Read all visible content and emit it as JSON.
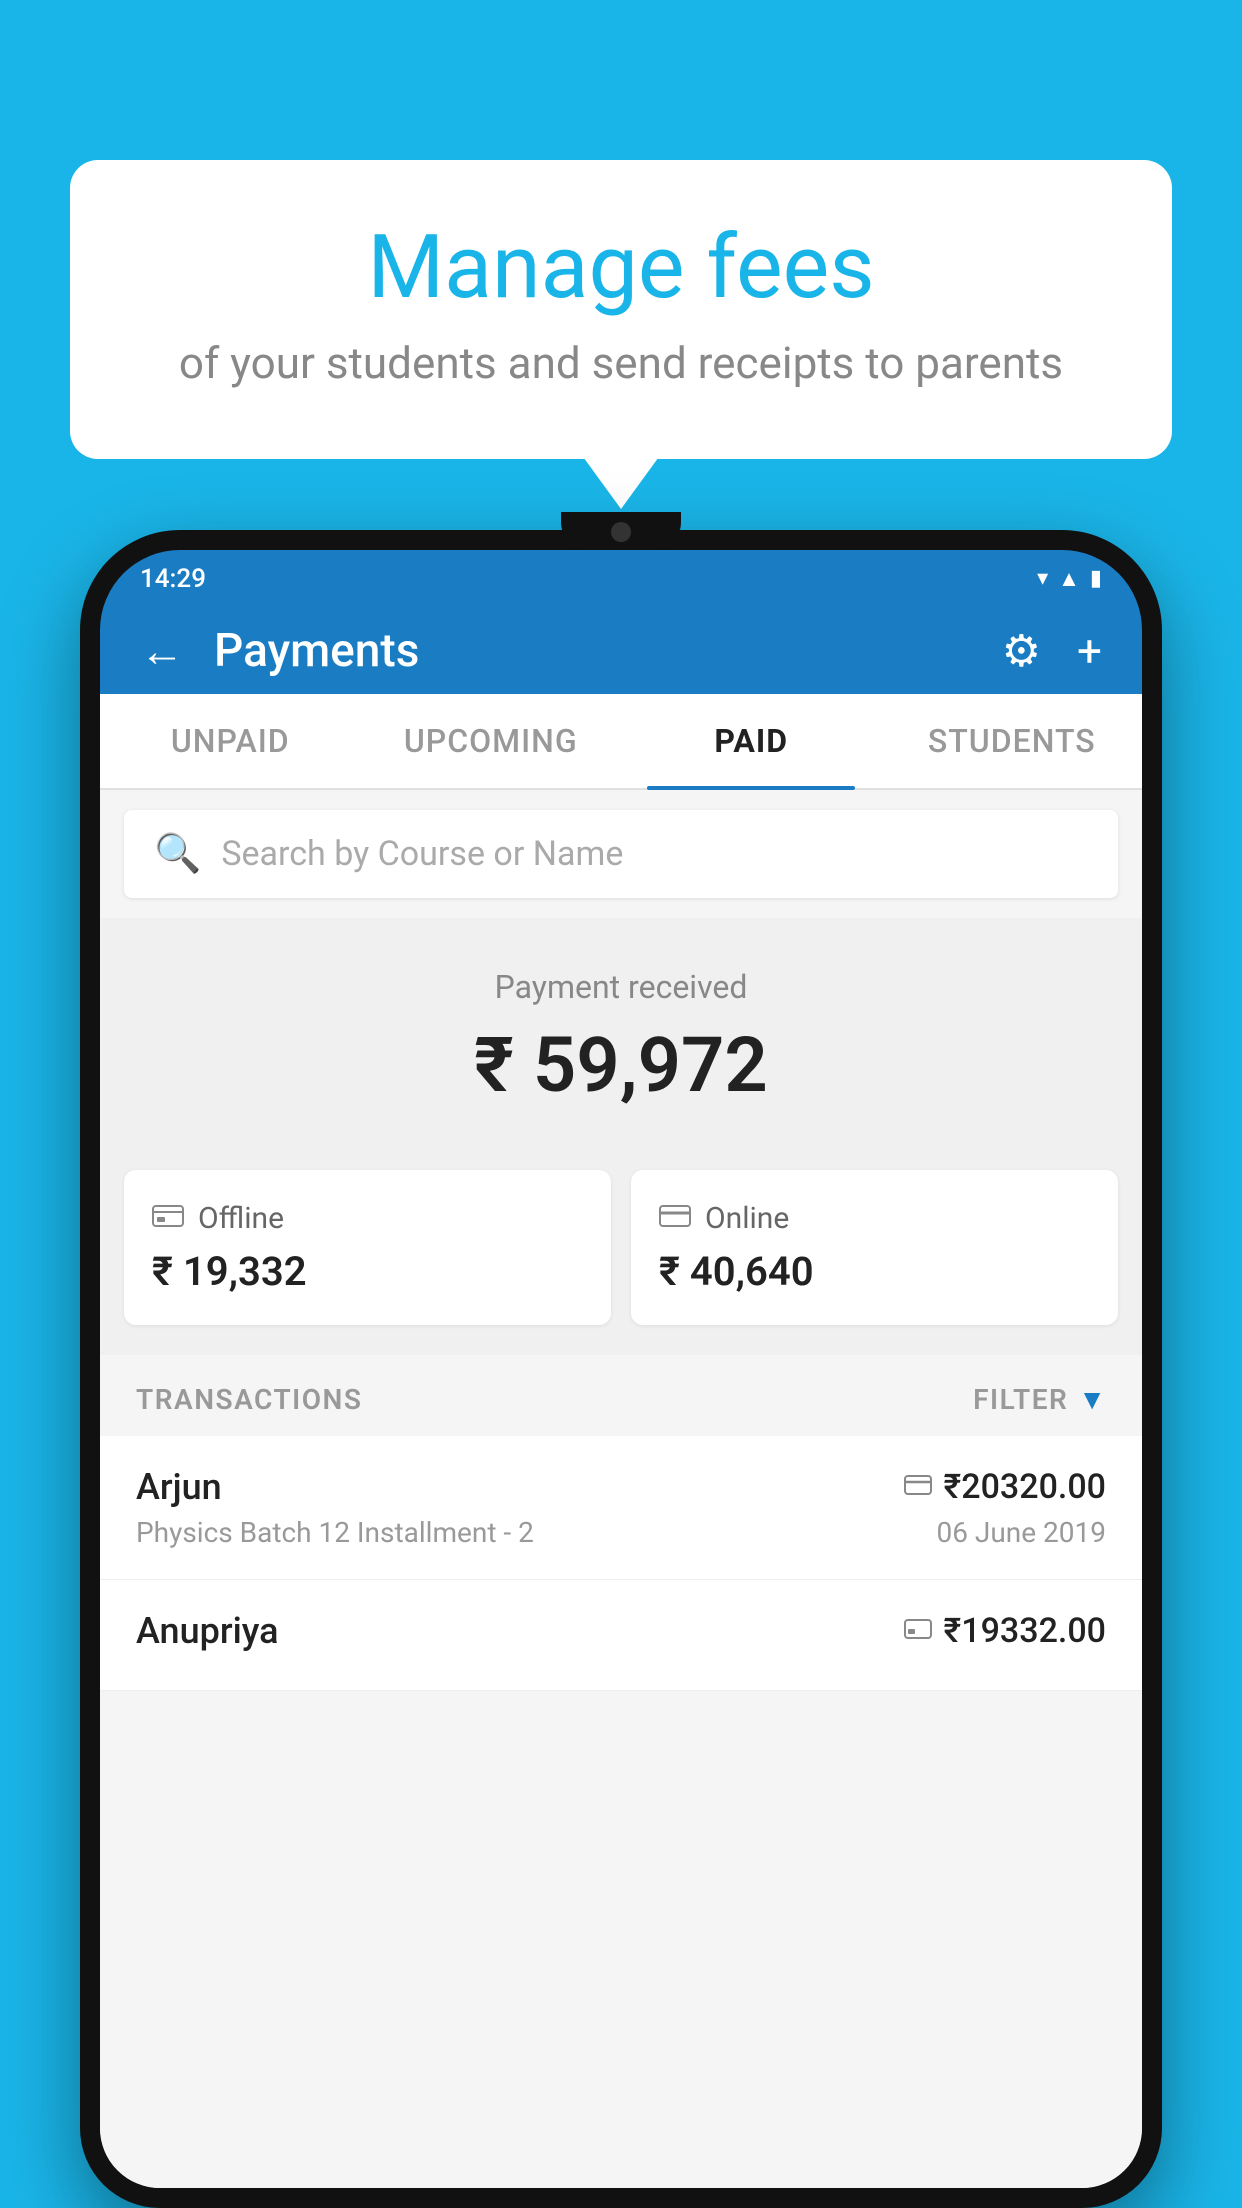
{
  "background_color": "#1ab5e8",
  "bubble": {
    "title": "Manage fees",
    "subtitle": "of your students and send receipts to parents"
  },
  "phone": {
    "status_bar": {
      "time": "14:29",
      "wifi": "▼",
      "signal": "▲",
      "battery": "▮"
    },
    "header": {
      "back_label": "←",
      "title": "Payments",
      "settings_icon": "⚙",
      "add_icon": "+"
    },
    "tabs": [
      {
        "label": "UNPAID",
        "active": false
      },
      {
        "label": "UPCOMING",
        "active": false
      },
      {
        "label": "PAID",
        "active": true
      },
      {
        "label": "STUDENTS",
        "active": false
      }
    ],
    "search": {
      "placeholder": "Search by Course or Name"
    },
    "payment_received": {
      "label": "Payment received",
      "amount": "₹ 59,972"
    },
    "cards": [
      {
        "icon": "💳",
        "label": "Offline",
        "amount": "₹ 19,332"
      },
      {
        "icon": "💳",
        "label": "Online",
        "amount": "₹ 40,640"
      }
    ],
    "transactions": {
      "label": "TRANSACTIONS",
      "filter_label": "FILTER"
    },
    "transaction_rows": [
      {
        "name": "Arjun",
        "course": "Physics Batch 12 Installment - 2",
        "amount": "₹20320.00",
        "date": "06 June 2019",
        "icon": "💳"
      },
      {
        "name": "Anupriya",
        "course": "",
        "amount": "₹19332.00",
        "date": "",
        "icon": "💳"
      }
    ]
  }
}
